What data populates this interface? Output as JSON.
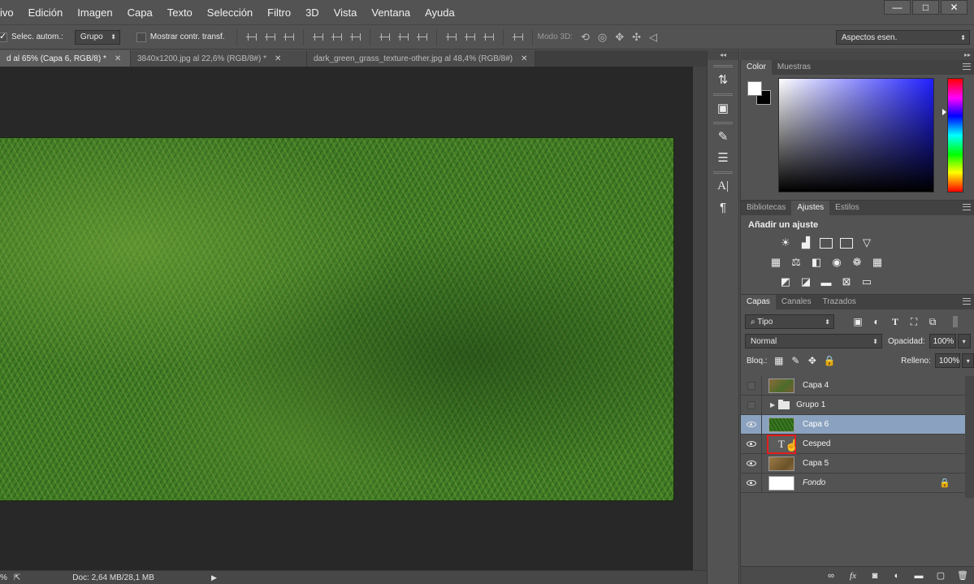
{
  "menu": {
    "items": [
      "ivo",
      "Edición",
      "Imagen",
      "Capa",
      "Texto",
      "Selección",
      "Filtro",
      "3D",
      "Vista",
      "Ventana",
      "Ayuda"
    ],
    "window_controls": [
      "—",
      "□",
      "✕"
    ]
  },
  "options": {
    "auto_select_label": "Selec. autom.:",
    "auto_select_value": "Grupo",
    "transform_label": "Mostrar contr. transf.",
    "mode3d_label": "Modo 3D:",
    "workspace": "Aspectos esen."
  },
  "tabs": [
    {
      "label": "d al 65% (Capa 6, RGB/8) *",
      "active": true
    },
    {
      "label": "3840x1200.jpg al 22,6% (RGB/8#) *",
      "active": false
    },
    {
      "label": "dark_green_grass_texture-other.jpg al 48,4% (RGB/8#)",
      "active": false
    }
  ],
  "status": {
    "zoom": "%",
    "doc": "Doc: 2,64 MB/28,1 MB"
  },
  "color_panel": {
    "tabs": [
      "Color",
      "Muestras"
    ],
    "foreground": "#ffffff",
    "background": "#000000",
    "hue_color": "#1f1fff"
  },
  "adjust_panel": {
    "tabs": [
      "Bibliotecas",
      "Ajustes",
      "Estilos"
    ],
    "title": "Añadir un ajuste"
  },
  "layers_panel": {
    "tabs": [
      "Capas",
      "Canales",
      "Trazados"
    ],
    "filter": "Tipo",
    "blend_mode": "Normal",
    "opacity_label": "Opacidad:",
    "opacity_value": "100%",
    "lock_label": "Bloq.:",
    "fill_label": "Relleno:",
    "fill_value": "100%",
    "layers": [
      {
        "name": "Capa 4",
        "visible": false,
        "thumb": "grass1"
      },
      {
        "name": "Grupo 1",
        "visible": false,
        "thumb": "folder"
      },
      {
        "name": "Capa 6",
        "visible": true,
        "thumb": "grass2",
        "selected": true
      },
      {
        "name": "Cesped",
        "visible": true,
        "thumb": "text"
      },
      {
        "name": "Capa 5",
        "visible": true,
        "thumb": "dirt"
      },
      {
        "name": "Fondo",
        "visible": true,
        "thumb": "white",
        "locked": true
      }
    ]
  },
  "icons": {
    "text_layer_glyph": "T",
    "lock_glyph": "🔒",
    "fx_label": "fx"
  }
}
